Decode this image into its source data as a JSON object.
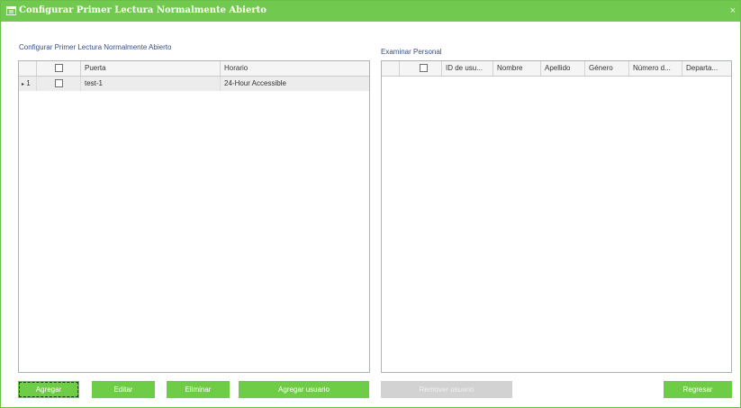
{
  "window": {
    "title": "Configurar Primer Lectura Normalmente Abierto",
    "close_glyph": "×",
    "accent_color": "#72c94f"
  },
  "left_panel": {
    "label": "Configurar Primer Lectura Normalmente Abierto",
    "columns": [
      "",
      "Puerta",
      "Horario"
    ],
    "rows": [
      {
        "indicator": "▸",
        "num": "1",
        "door": "test-1",
        "schedule": "24-Hour Accessible"
      }
    ]
  },
  "right_panel": {
    "label": "Examinar Personal",
    "columns": [
      "",
      "ID de usu...",
      "Nombre",
      "Apellido",
      "Género",
      "Número d...",
      "Departa..."
    ]
  },
  "buttons": {
    "add": "Agregar",
    "edit": "Editar",
    "delete": "Eliminar",
    "add_user": "Agregar usuario",
    "remove_user": "Remover usuario",
    "back": "Regresar"
  },
  "icons": {
    "title_icon": "calendar-icon",
    "row_indicator": "row-pointer-icon"
  }
}
